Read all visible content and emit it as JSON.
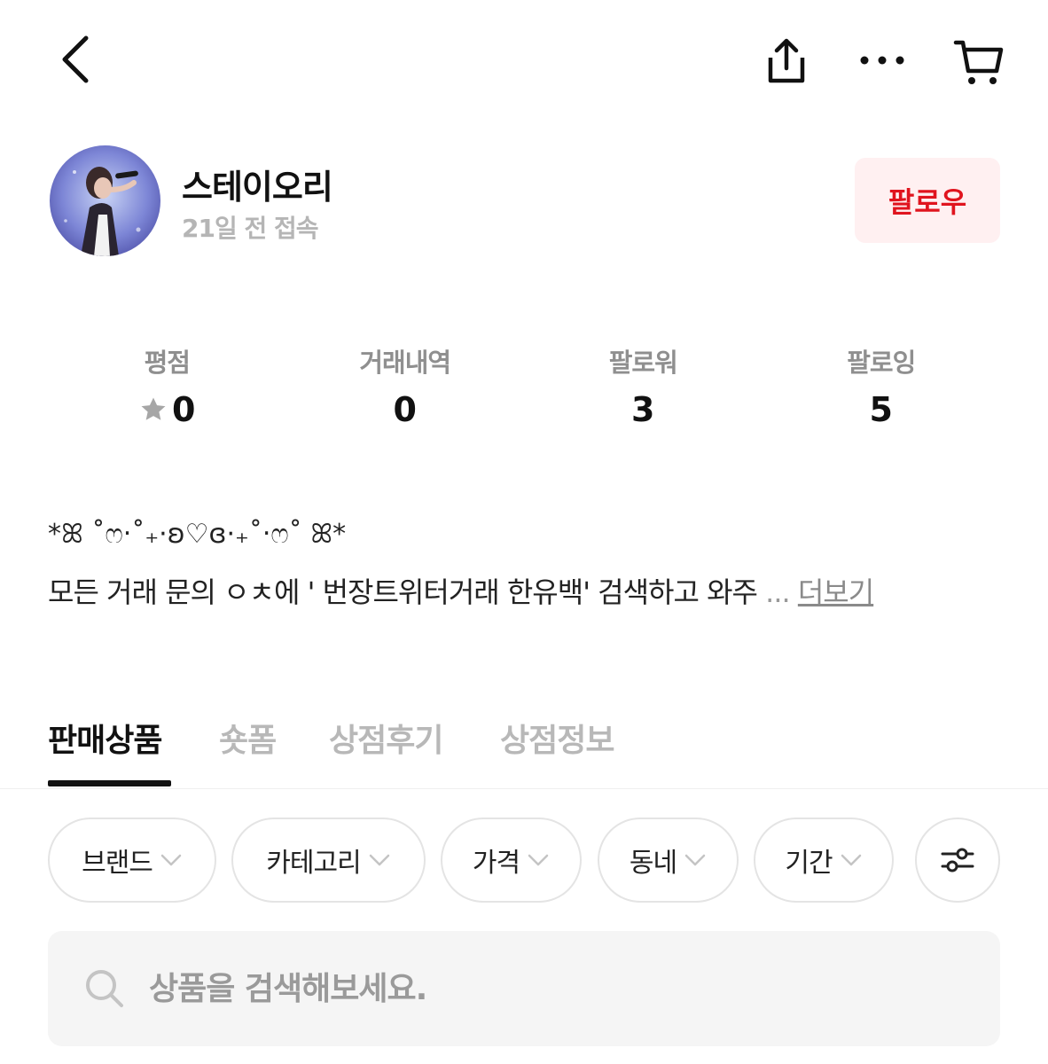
{
  "header": {
    "back_icon": "chevron-left-icon",
    "share_icon": "share-icon",
    "more_icon": "more-horizontal-icon",
    "cart_icon": "cart-icon"
  },
  "profile": {
    "name": "스테이오리",
    "last_seen": "21일 전 접속",
    "follow_label": "팔로우",
    "avatar": "singer-with-microphone-photo"
  },
  "stats": [
    {
      "label": "평점",
      "value": "0",
      "icon": "star-icon"
    },
    {
      "label": "거래내역",
      "value": "0"
    },
    {
      "label": "팔로워",
      "value": "3"
    },
    {
      "label": "팔로잉",
      "value": "5"
    }
  ],
  "bio": {
    "decoration": "*ꕤ ˚ෆ‧˚₊·ʚ♡ɞ·₊˚‧ෆ˚ ꕤ*",
    "text": "모든 거래 문의 ㅇㅊ에 ' 번장트위터거래 한유백' 검색하고 와주",
    "ellipsis": "...",
    "more_label": "더보기"
  },
  "tabs": [
    {
      "label": "판매상품",
      "active": true
    },
    {
      "label": "숏폼",
      "active": false
    },
    {
      "label": "상점후기",
      "active": false
    },
    {
      "label": "상점정보",
      "active": false
    }
  ],
  "filters": [
    {
      "label": "브랜드"
    },
    {
      "label": "카테고리"
    },
    {
      "label": "가격"
    },
    {
      "label": "동네"
    },
    {
      "label": "기간"
    }
  ],
  "filter_settings_icon": "sliders-icon",
  "search": {
    "placeholder": "상품을 검색해보세요.",
    "icon": "search-icon"
  },
  "colors": {
    "accent": "#e0141e",
    "follow_bg": "#fff0f1",
    "muted": "#b5b5b5"
  }
}
